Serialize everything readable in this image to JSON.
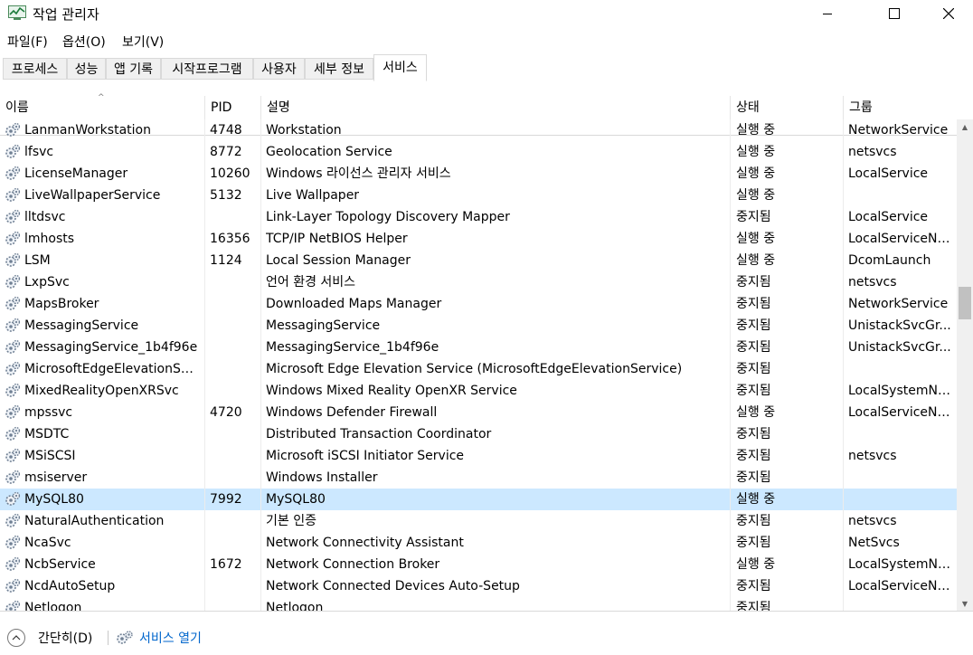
{
  "window": {
    "title": "작업 관리자",
    "minimize_glyph": "—",
    "close_glyph": "✕"
  },
  "menu": [
    "파일(F)",
    "옵션(O)",
    "보기(V)"
  ],
  "tabs": [
    {
      "label": "프로세스",
      "active": false
    },
    {
      "label": "성능",
      "active": false
    },
    {
      "label": "앱 기록",
      "active": false
    },
    {
      "label": "시작프로그램",
      "active": false
    },
    {
      "label": "사용자",
      "active": false
    },
    {
      "label": "세부 정보",
      "active": false
    },
    {
      "label": "서비스",
      "active": true
    }
  ],
  "columns": {
    "name": "이름",
    "pid": "PID",
    "description": "설명",
    "status": "상태",
    "group": "그룹"
  },
  "services": [
    {
      "name": "LanmanWorkstation",
      "pid": "4748",
      "description": "Workstation",
      "status": "실행 중",
      "group": "NetworkService"
    },
    {
      "name": "lfsvc",
      "pid": "8772",
      "description": "Geolocation Service",
      "status": "실행 중",
      "group": "netsvcs"
    },
    {
      "name": "LicenseManager",
      "pid": "10260",
      "description": "Windows 라이선스 관리자 서비스",
      "status": "실행 중",
      "group": "LocalService"
    },
    {
      "name": "LiveWallpaperService",
      "pid": "5132",
      "description": "Live Wallpaper",
      "status": "실행 중",
      "group": ""
    },
    {
      "name": "lltdsvc",
      "pid": "",
      "description": "Link-Layer Topology Discovery Mapper",
      "status": "중지됨",
      "group": "LocalService"
    },
    {
      "name": "lmhosts",
      "pid": "16356",
      "description": "TCP/IP NetBIOS Helper",
      "status": "실행 중",
      "group": "LocalServiceNe..."
    },
    {
      "name": "LSM",
      "pid": "1124",
      "description": "Local Session Manager",
      "status": "실행 중",
      "group": "DcomLaunch"
    },
    {
      "name": "LxpSvc",
      "pid": "",
      "description": "언어 환경 서비스",
      "status": "중지됨",
      "group": "netsvcs"
    },
    {
      "name": "MapsBroker",
      "pid": "",
      "description": "Downloaded Maps Manager",
      "status": "중지됨",
      "group": "NetworkService"
    },
    {
      "name": "MessagingService",
      "pid": "",
      "description": "MessagingService",
      "status": "중지됨",
      "group": "UnistackSvcGr..."
    },
    {
      "name": "MessagingService_1b4f96e",
      "pid": "",
      "description": "MessagingService_1b4f96e",
      "status": "중지됨",
      "group": "UnistackSvcGr..."
    },
    {
      "name": "MicrosoftEdgeElevationSer...",
      "pid": "",
      "description": "Microsoft Edge Elevation Service (MicrosoftEdgeElevationService)",
      "status": "중지됨",
      "group": ""
    },
    {
      "name": "MixedRealityOpenXRSvc",
      "pid": "",
      "description": "Windows Mixed Reality OpenXR Service",
      "status": "중지됨",
      "group": "LocalSystemNe..."
    },
    {
      "name": "mpssvc",
      "pid": "4720",
      "description": "Windows Defender Firewall",
      "status": "실행 중",
      "group": "LocalServiceNo..."
    },
    {
      "name": "MSDTC",
      "pid": "",
      "description": "Distributed Transaction Coordinator",
      "status": "중지됨",
      "group": ""
    },
    {
      "name": "MSiSCSI",
      "pid": "",
      "description": "Microsoft iSCSI Initiator Service",
      "status": "중지됨",
      "group": "netsvcs"
    },
    {
      "name": "msiserver",
      "pid": "",
      "description": "Windows Installer",
      "status": "중지됨",
      "group": ""
    },
    {
      "name": "MySQL80",
      "pid": "7992",
      "description": "MySQL80",
      "status": "실행 중",
      "group": "",
      "selected": true
    },
    {
      "name": "NaturalAuthentication",
      "pid": "",
      "description": "기본 인증",
      "status": "중지됨",
      "group": "netsvcs"
    },
    {
      "name": "NcaSvc",
      "pid": "",
      "description": "Network Connectivity Assistant",
      "status": "중지됨",
      "group": "NetSvcs"
    },
    {
      "name": "NcbService",
      "pid": "1672",
      "description": "Network Connection Broker",
      "status": "실행 중",
      "group": "LocalSystemNe..."
    },
    {
      "name": "NcdAutoSetup",
      "pid": "",
      "description": "Network Connected Devices Auto-Setup",
      "status": "중지됨",
      "group": "LocalServiceNo..."
    },
    {
      "name": "Netlogon",
      "pid": "",
      "description": "Netlogon",
      "status": "중지됨",
      "group": ""
    }
  ],
  "footer": {
    "fewer_details": "간단히(D)",
    "open_services": "서비스 열기"
  },
  "colors": {
    "selected_row": "#cce8ff",
    "link": "#0066cc"
  },
  "icons": {
    "service_row": "gears-icon",
    "footer_services": "gears-icon",
    "fewer_details": "chevron-up-circle-icon"
  }
}
